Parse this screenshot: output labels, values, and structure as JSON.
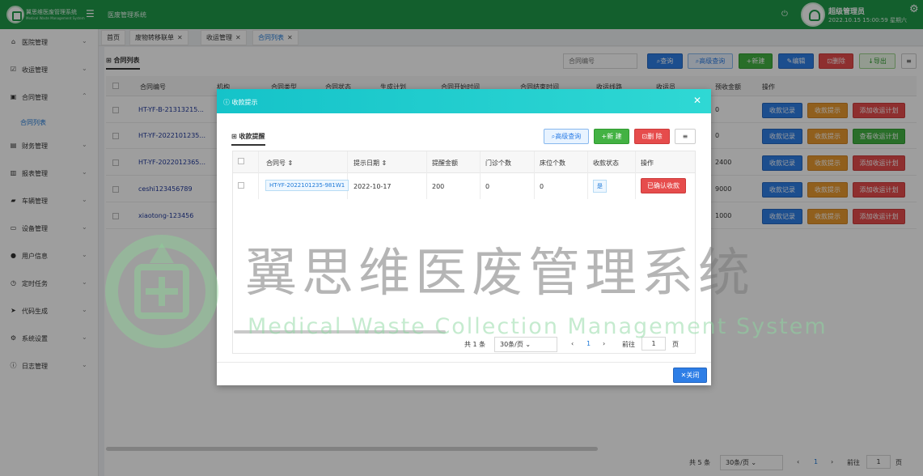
{
  "app": {
    "brand": "翼思维医废管理系统",
    "brand_sub": "Medical Waste Management System",
    "system_title": "医废管理系统",
    "user": "超级管理员",
    "datetime": "2022.10.15 15:00:59 星期六"
  },
  "sidebar": {
    "items": [
      {
        "label": "医院管理",
        "icon": "home-icon"
      },
      {
        "label": "收运管理",
        "icon": "check-square-icon"
      },
      {
        "label": "合同管理",
        "icon": "briefcase-icon"
      },
      {
        "label": "财务管理",
        "icon": "wallet-icon"
      },
      {
        "label": "报表管理",
        "icon": "bar-chart-icon"
      },
      {
        "label": "车辆管理",
        "icon": "truck-icon"
      },
      {
        "label": "设备管理",
        "icon": "monitor-icon"
      },
      {
        "label": "用户信息",
        "icon": "user-icon"
      },
      {
        "label": "定时任务",
        "icon": "clock-icon"
      },
      {
        "label": "代码生成",
        "icon": "send-icon"
      },
      {
        "label": "系统设置",
        "icon": "settings-icon"
      },
      {
        "label": "日志管理",
        "icon": "info-icon"
      }
    ],
    "sub_item": "合同列表"
  },
  "tabs": [
    {
      "label": "首页"
    },
    {
      "label": "废物转移联单"
    },
    {
      "label": "收运管理"
    },
    {
      "label": "合同列表"
    }
  ],
  "page": {
    "subtitle": "合同列表",
    "search_placeholder": "合同编号",
    "buttons": {
      "query": "查询",
      "advanced": "高级查询",
      "add": "新建",
      "edit": "编辑",
      "delete": "删除",
      "export": "导出"
    },
    "columns": [
      "合同编号",
      "机构",
      "合同类型",
      "合同状态",
      "生成计划",
      "合同开始时间",
      "合同结束时间",
      "收运线路",
      "收运员",
      "预收金额",
      "操作"
    ],
    "rows": [
      {
        "code": "HT-YF-B-21313215...",
        "amount": "0",
        "ops": [
          "收款记录",
          "收款提示",
          "添加收运计划"
        ]
      },
      {
        "code": "HT-YF-2022101235...",
        "amount": "0",
        "ops": [
          "收款记录",
          "收款提示",
          "查看收运计划"
        ]
      },
      {
        "code": "HT-YF-2022012365...",
        "amount": "2400",
        "ops": [
          "收款记录",
          "收款提示",
          "添加收运计划"
        ]
      },
      {
        "code": "ceshi123456789",
        "amount": "9000",
        "ops": [
          "收款记录",
          "收款提示",
          "添加收运计划"
        ]
      },
      {
        "code": "xiaotong-123456",
        "amount": "1000",
        "ops": [
          "收款记录",
          "收款提示",
          "添加收运计划"
        ]
      }
    ],
    "pager": {
      "total": "共 5 条",
      "size": "30条/页",
      "current": "1",
      "goto": "前往",
      "page_unit": "页"
    }
  },
  "modal": {
    "title": "收款提示",
    "subtitle": "收款提醒",
    "buttons": {
      "advanced": "高级查询",
      "add": "新 建",
      "delete": "删 除",
      "menu": "≡",
      "close": "关闭"
    },
    "columns": [
      "合同号",
      "提示日期",
      "提醒金额",
      "门诊个数",
      "床位个数",
      "收款状态",
      "操作"
    ],
    "row": {
      "code": "HT-YF-2022101235-981W1",
      "date": "2022-10-17",
      "amount": "200",
      "clinics": "0",
      "beds": "0",
      "status": "是",
      "action": "已确认收款"
    },
    "pager": {
      "total": "共 1 条",
      "size": "30条/页",
      "current": "1",
      "goto": "前往",
      "page_unit": "页"
    }
  },
  "watermark": {
    "cn": "翼思维医废管理系统",
    "en": "Medical Waste Collection Management System"
  },
  "colors": {
    "header": "#1f9a4a",
    "modal_header": "#15c3c9",
    "primary": "#2e7ee6",
    "danger": "#e64c4c",
    "warning": "#e8992f",
    "success": "#43b243"
  }
}
